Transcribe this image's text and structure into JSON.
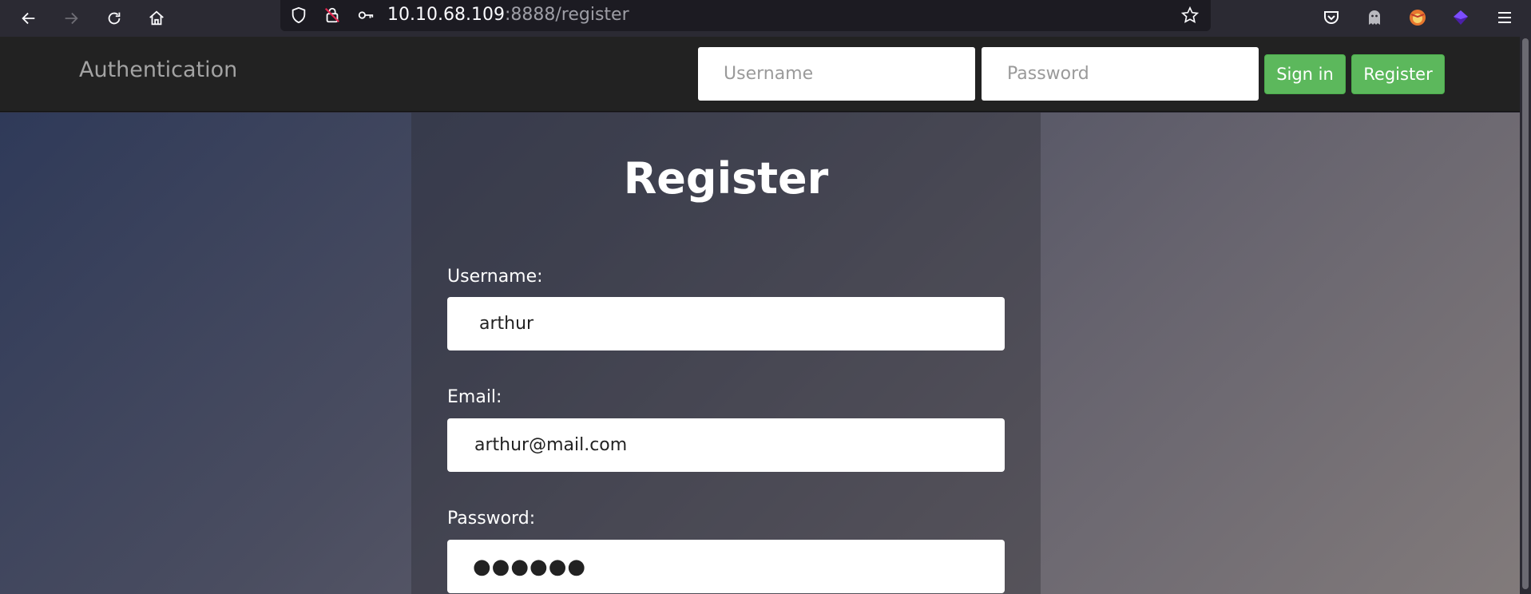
{
  "browser": {
    "url_host": "10.10.68.109",
    "url_path": ":8888/register",
    "icons": [
      "back-icon",
      "forward-icon",
      "reload-icon",
      "home-icon",
      "shield-icon",
      "insecure-lock-icon",
      "key-icon",
      "bookmark-star-icon",
      "pocket-icon",
      "ghostery-icon",
      "foxyproxy-icon",
      "wappalyzer-icon",
      "menu-icon"
    ]
  },
  "navbar": {
    "brand": "Authentication",
    "username_placeholder": "Username",
    "password_placeholder": "Password",
    "signin_label": "Sign in",
    "register_label": "Register",
    "button_color": "#5cb85c"
  },
  "register_form": {
    "title": "Register",
    "username_label": "Username:",
    "username_value": "arthur",
    "email_label": "Email:",
    "email_value": "arthur@mail.com",
    "password_label": "Password:",
    "password_value": "●●●●●●"
  }
}
